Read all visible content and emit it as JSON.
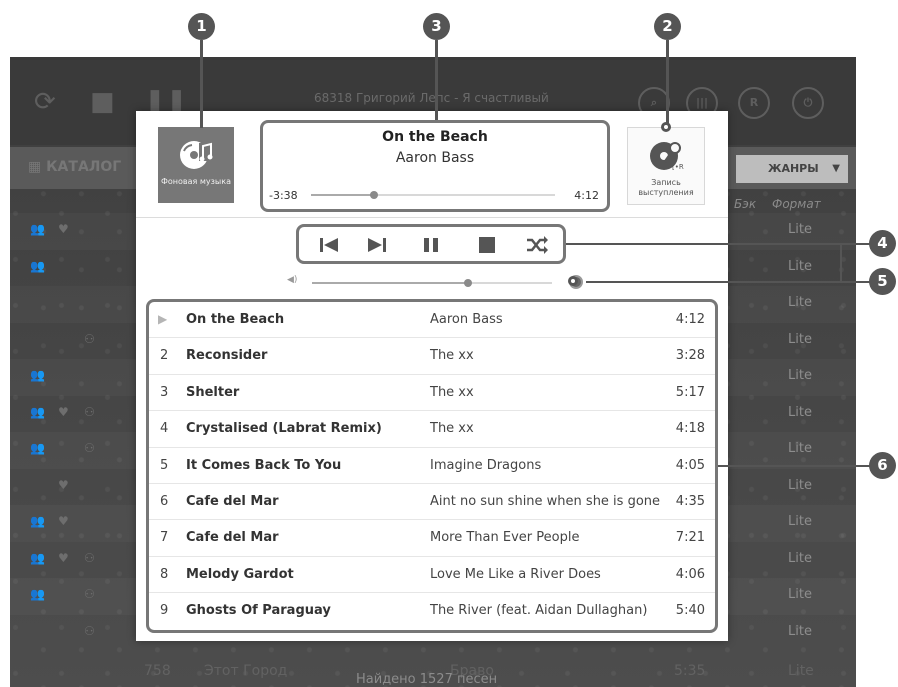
{
  "background_app": {
    "now_playing_text": "68318  Григорий Лепс - Я счастливый",
    "catalog_label": "КАТАЛОГ",
    "genres_label": "ЖАНРЫ",
    "col_back": "Бэк",
    "col_format": "Формат",
    "format_value": "Lite",
    "bottom_row": {
      "number": "758",
      "title": "Этот Город",
      "artist": "Браво",
      "duration": "5:35"
    },
    "found_text": "Найдено 1527 песен"
  },
  "player": {
    "bg_music_label": "Фоновая музыка",
    "record_label": "Запись выступления",
    "record_badge": "[•R]",
    "now_playing": {
      "title": "On the Beach",
      "artist": "Aaron Bass",
      "elapsed": "-3:38",
      "total": "4:12",
      "progress": 0.26
    },
    "volume": 0.65,
    "controls": [
      "previous-icon",
      "next-icon",
      "pause-icon",
      "stop-icon",
      "shuffle-icon"
    ],
    "playlist": [
      {
        "num": "",
        "title": "On the Beach",
        "artist": "Aaron Bass",
        "duration": "4:12",
        "playing": true
      },
      {
        "num": "2",
        "title": "Reconsider",
        "artist": "The xx",
        "duration": "3:28"
      },
      {
        "num": "3",
        "title": "Shelter",
        "artist": "The xx",
        "duration": "5:17"
      },
      {
        "num": "4",
        "title": "Crystalised (Labrat Remix)",
        "artist": "The xx",
        "duration": "4:18"
      },
      {
        "num": "5",
        "title": "It Comes Back To You",
        "artist": "Imagine Dragons",
        "duration": "4:05"
      },
      {
        "num": "6",
        "title": "Cafe del Mar",
        "artist": "Aint no sun shine when she is gone",
        "duration": "4:35"
      },
      {
        "num": "7",
        "title": "Cafe del Mar",
        "artist": "More Than Ever People",
        "duration": "7:21"
      },
      {
        "num": "8",
        "title": "Melody Gardot",
        "artist": "Love Me Like a River Does",
        "duration": "4:06"
      },
      {
        "num": "9",
        "title": "Ghosts Of Paraguay",
        "artist": "The River (feat. Aidan Dullaghan)",
        "duration": "5:40"
      }
    ]
  },
  "callouts": [
    "1",
    "2",
    "3",
    "4",
    "5",
    "6"
  ],
  "colors": {
    "callout": "#555555",
    "tile_bg": "#777777",
    "outline": "#777777"
  }
}
